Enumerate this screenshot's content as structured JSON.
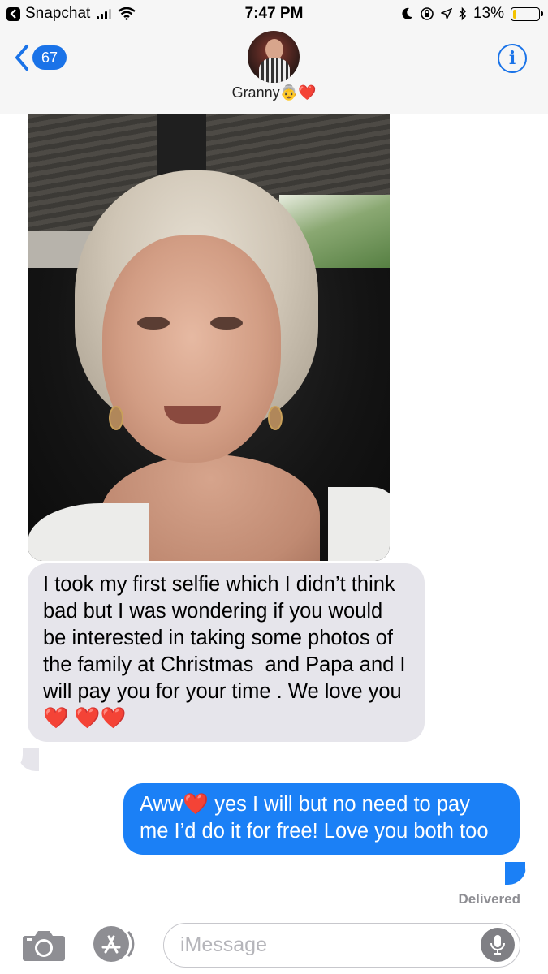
{
  "status_bar": {
    "back_app": "Snapchat",
    "time": "7:47 PM",
    "battery": "13%",
    "battery_level": 0.13,
    "battery_color": "#f4c300"
  },
  "header": {
    "unread_count": "67",
    "contact_name": "Granny",
    "name_emoji": "👵❤️",
    "info_label": "i",
    "accent_color": "#1a73e8"
  },
  "messages": {
    "incoming_text": "I took my first selfie which I didn’t think bad but I was wondering if you would be interested in taking some photos of the family at Christmas  and Papa and I will pay you for your time . We love you ",
    "incoming_hearts": "❤️ ❤️❤️",
    "outgoing_prefix": "Aww",
    "outgoing_heart": "❤️",
    "outgoing_text": " yes I will but no need to pay me I’d do it for free! Love you both too",
    "delivered": "Delivered",
    "incoming_color": "#e6e5eb",
    "outgoing_color": "#1b80f6"
  },
  "input_bar": {
    "placeholder": "iMessage"
  }
}
